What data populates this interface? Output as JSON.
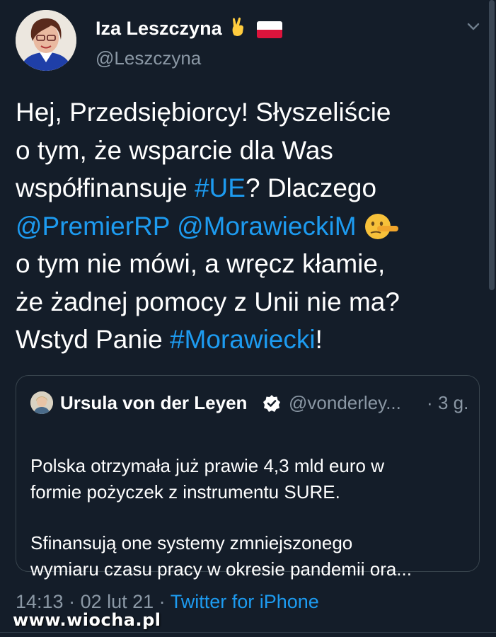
{
  "author": {
    "display_name": "Iza Leszczyna",
    "emoji_victory": "✌️",
    "handle": "@Leszczyna"
  },
  "tweet": {
    "lines": [
      "Hej, Przedsiębiorcy! Słyszeliście",
      "o tym, że wsparcie dla Was",
      "współfinansuje ",
      "? Dlaczego",
      "o tym nie mówi, a wręcz kłamie,",
      "że żadnej pomocy z Unii nie ma?",
      "Wstyd Panie ",
      "!"
    ],
    "hashtag_ue": "#UE",
    "mention_premier": "@PremierRP",
    "mention_morawiecki": "@MorawieckiM",
    "hashtag_morawiecki": "#Morawiecki"
  },
  "quote": {
    "name": "Ursula von der Leyen",
    "handle": "@vonderley...",
    "separator": "·",
    "time": "3 g.",
    "para1_line1": "Polska otrzymała już prawie 4,3 mld euro w",
    "para1_line2": "formie pożyczek z instrumentu SURE.",
    "para2_line1": "Sfinansują one systemy zmniejszonego",
    "para2_line2": "wymiaru czasu pracy w okresie pandemii ora..."
  },
  "footer": {
    "time": "14:13",
    "sep1": " · ",
    "date": "02 lut 21",
    "sep2": " · ",
    "source": "Twitter for iPhone"
  },
  "watermark": "www.wiocha.pl",
  "colors": {
    "background": "#141d29",
    "link": "#1d9bf0",
    "muted": "#8b98a5",
    "border": "#38444d",
    "flag_red": "#dc143c"
  },
  "icons": {
    "chevron": "chevron-down-icon",
    "verified": "verified-badge-icon",
    "lying_face": "lying-face-emoji"
  }
}
